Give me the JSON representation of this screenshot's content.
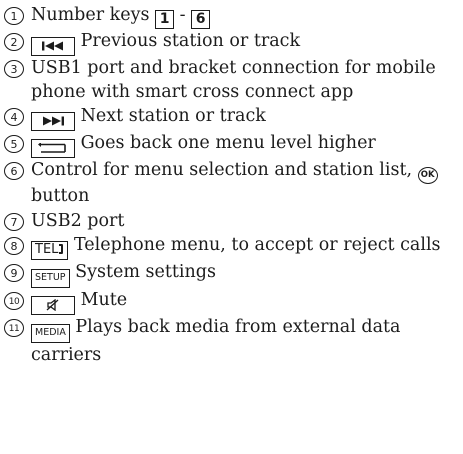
{
  "items": [
    {
      "number": "1",
      "text_before": "Number keys",
      "key_1": "1",
      "separator": "-",
      "key_2": "6"
    },
    {
      "number": "2",
      "key_icon": "previous-track-icon",
      "text": "Previous station or track"
    },
    {
      "number": "3",
      "text": "USB1 port and bracket connection for mobile phone with smart cross connect app"
    },
    {
      "number": "4",
      "key_icon": "next-track-icon",
      "text": "Next station or track"
    },
    {
      "number": "5",
      "key_icon": "back-arrow-icon",
      "text": "Goes back one menu level higher"
    },
    {
      "number": "6",
      "text_before": "Control for menu selection and station list,",
      "ok_label": "OK",
      "text_after": "button"
    },
    {
      "number": "7",
      "text": "USB2 port"
    },
    {
      "number": "8",
      "key_label": "TEL",
      "key_icon": "phone-icon",
      "text": "Telephone menu, to accept or reject calls"
    },
    {
      "number": "9",
      "key_label": "SETUP",
      "text": "System settings"
    },
    {
      "number": "10",
      "key_icon": "mute-icon",
      "text": "Mute"
    },
    {
      "number": "11",
      "key_label": "MEDIA",
      "text": "Plays back media from external data carriers"
    }
  ]
}
